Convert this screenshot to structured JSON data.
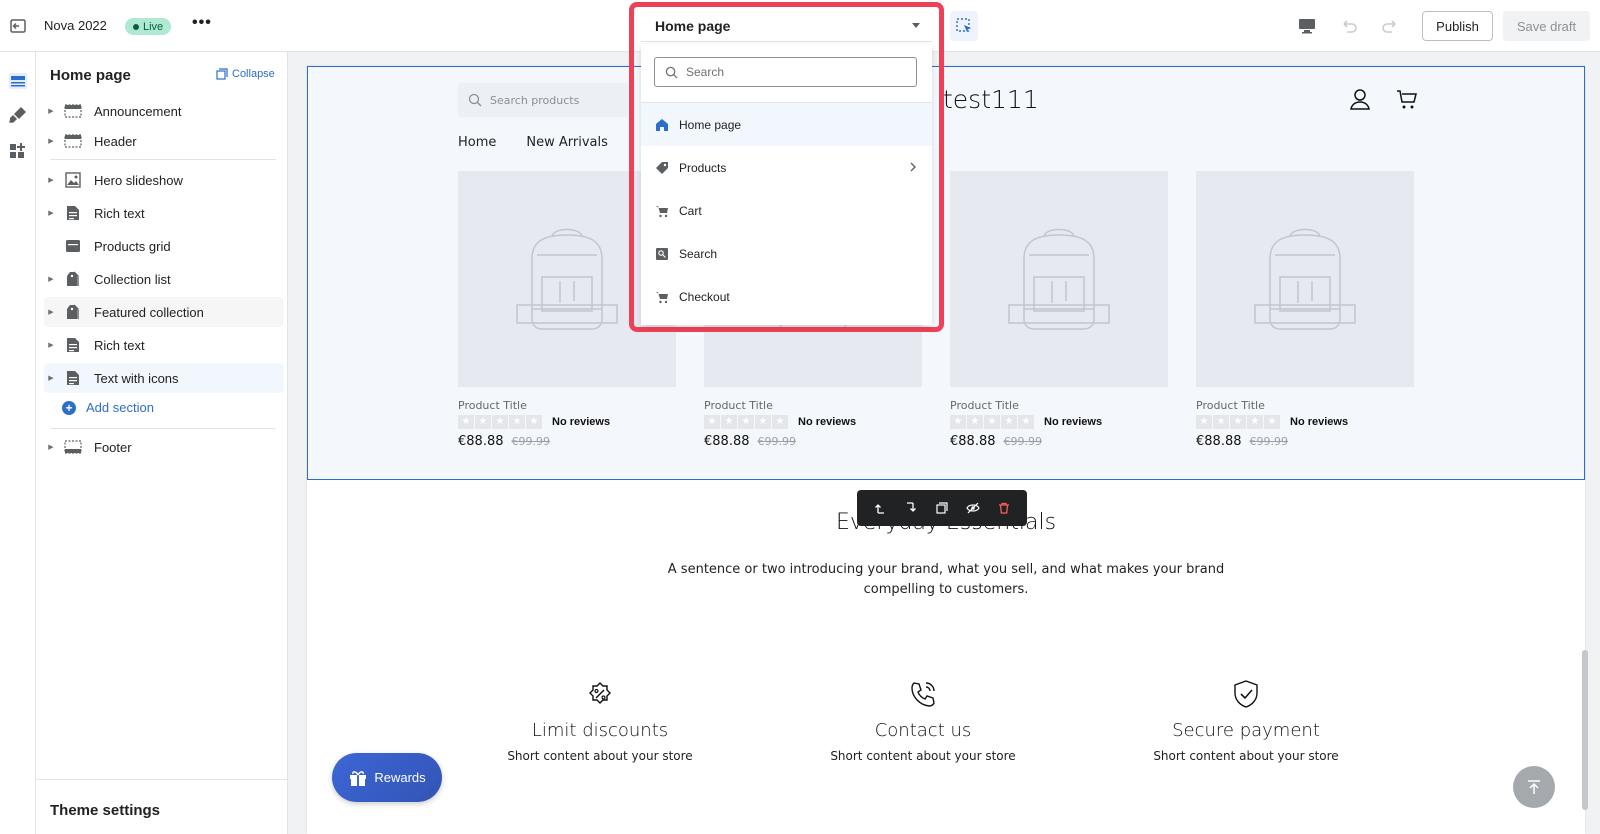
{
  "topbar": {
    "store_name": "Nova 2022",
    "status_badge": "Live",
    "more": "•••",
    "publish_label": "Publish",
    "save_draft_label": "Save draft"
  },
  "template_selector": {
    "current": "Home page",
    "search_placeholder": "Search",
    "options": [
      {
        "label": "Home page",
        "icon": "home-icon",
        "selected": true
      },
      {
        "label": "Products",
        "icon": "tag-icon",
        "has_submenu": true
      },
      {
        "label": "Cart",
        "icon": "cart-icon"
      },
      {
        "label": "Search",
        "icon": "search-list-icon"
      },
      {
        "label": "Checkout",
        "icon": "cart-icon"
      }
    ]
  },
  "sidebar": {
    "title": "Home page",
    "collapse_label": "Collapse",
    "items": [
      {
        "label": "Announcement",
        "icon": "announcement-icon"
      },
      {
        "label": "Header",
        "icon": "header-icon"
      },
      {
        "label": "Hero slideshow",
        "icon": "image-icon"
      },
      {
        "label": "Rich text",
        "icon": "text-icon"
      },
      {
        "label": "Products grid",
        "icon": "grid-icon"
      },
      {
        "label": "Collection list",
        "icon": "collection-icon"
      },
      {
        "label": "Featured collection",
        "icon": "collection-icon"
      },
      {
        "label": "Rich text",
        "icon": "text-icon"
      },
      {
        "label": "Text with icons",
        "icon": "text-icon"
      },
      {
        "label": "Footer",
        "icon": "footer-icon"
      }
    ],
    "add_section_label": "Add section",
    "theme_settings_label": "Theme settings"
  },
  "preview": {
    "store_search_placeholder": "Search products",
    "store_name": "test111",
    "nav": [
      "Home",
      "New Arrivals"
    ],
    "products": [
      {
        "title": "Product Title",
        "reviews": "No reviews",
        "price": "€88.88",
        "compare_price": "€99.99"
      },
      {
        "title": "Product Title",
        "reviews": "No reviews",
        "price": "€88.88",
        "compare_price": "€99.99"
      },
      {
        "title": "Product Title",
        "reviews": "No reviews",
        "price": "€88.88",
        "compare_price": "€99.99"
      },
      {
        "title": "Product Title",
        "reviews": "No reviews",
        "price": "€88.88",
        "compare_price": "€99.99"
      }
    ],
    "essentials_title": "Everyday Essentials",
    "essentials_text": "A sentence or two introducing your brand, what you sell, and what makes your brand compelling to customers.",
    "features": [
      {
        "title": "Limit discounts",
        "text": "Short content about your store",
        "icon": "discount-icon"
      },
      {
        "title": "Contact us",
        "text": "Short content about your store",
        "icon": "phone-icon"
      },
      {
        "title": "Secure payment",
        "text": "Short content about your store",
        "icon": "shield-check-icon"
      }
    ],
    "rewards_label": "Rewards"
  },
  "colors": {
    "accent": "#2c6ecb",
    "highlight_outline": "#ef4058",
    "live_badge": "#aee9d1",
    "delete_icon": "#ff5b5b"
  }
}
